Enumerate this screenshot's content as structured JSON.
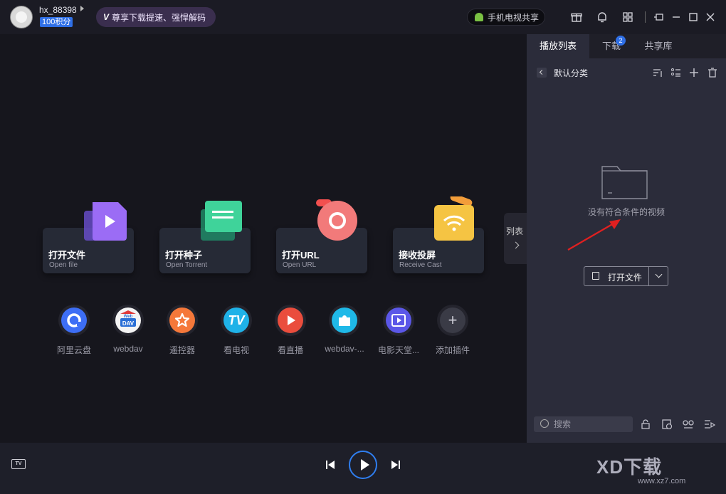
{
  "header": {
    "username": "hx_88398",
    "points": "100积分",
    "vip_banner": "尊享下载提速、强悍解码",
    "share_button": "手机电视共享"
  },
  "main": {
    "cards": [
      {
        "title": "打开文件",
        "subtitle": "Open file"
      },
      {
        "title": "打开种子",
        "subtitle": "Open Torrent"
      },
      {
        "title": "打开URL",
        "subtitle": "Open URL"
      },
      {
        "title": "接收投屏",
        "subtitle": "Receive Cast"
      }
    ],
    "plugins": [
      {
        "label": "阿里云盘"
      },
      {
        "label": "webdav",
        "icon_text": "Web\nDAV"
      },
      {
        "label": "遥控器"
      },
      {
        "label": "看电视",
        "icon_text": "TV"
      },
      {
        "label": "看直播"
      },
      {
        "label": "webdav-..."
      },
      {
        "label": "电影天堂..."
      },
      {
        "label": "添加插件"
      }
    ],
    "list_toggle": "列表"
  },
  "panel": {
    "tabs": [
      {
        "label": "播放列表"
      },
      {
        "label": "下载",
        "badge": "2"
      },
      {
        "label": "共享库"
      }
    ],
    "category": "默认分类",
    "empty_text": "没有符合条件的视频",
    "open_file_button": "打开文件",
    "search_placeholder": "搜索"
  },
  "watermark": {
    "text": "XD下载",
    "url": "www.xz7.com"
  }
}
